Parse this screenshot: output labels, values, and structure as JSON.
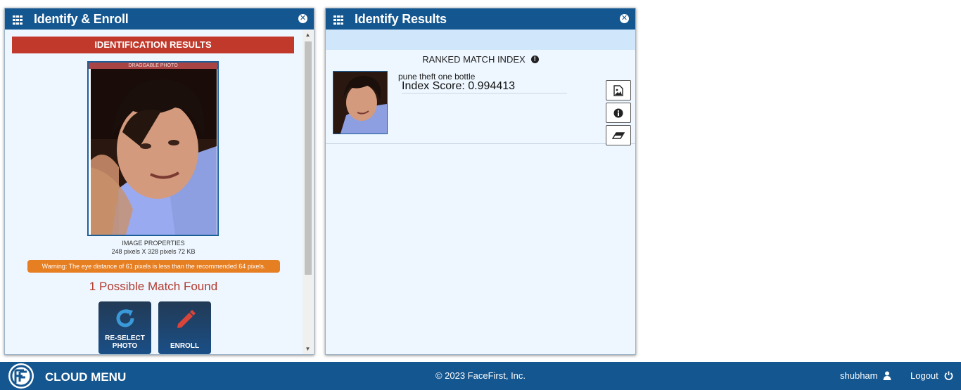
{
  "left_panel": {
    "title": "Identify & Enroll",
    "banner": "IDENTIFICATION RESULTS",
    "drag_label": "DRAGGABLE PHOTO",
    "image_props_title": "IMAGE PROPERTIES",
    "image_props_value": "248 pixels X 328 pixels 72 KB",
    "warning": "Warning: The eye distance of 61 pixels is less than the recommended 64 pixels.",
    "match_found": "1 Possible Match Found",
    "reselect_line1": "RE-SELECT",
    "reselect_line2": "PHOTO",
    "enroll_label": "ENROLL"
  },
  "right_panel": {
    "title": "Identify Results",
    "ranked_title": "RANKED MATCH INDEX",
    "case_name": "pune theft one bottle",
    "index_score": "Index Score: 0.994413"
  },
  "footer": {
    "cloud_menu": "CLOUD MENU",
    "copyright": "© 2023 FaceFirst, Inc.",
    "user": "shubham",
    "logout": "Logout"
  },
  "colors": {
    "header": "#14568f",
    "banner": "#c0392b",
    "warning": "#e67e22",
    "match_text": "#b03a2e"
  },
  "icons": [
    "grid-icon",
    "close-icon",
    "refresh-icon",
    "pencil-icon",
    "image-icon",
    "info-icon",
    "eraser-icon",
    "user-icon",
    "power-icon"
  ]
}
